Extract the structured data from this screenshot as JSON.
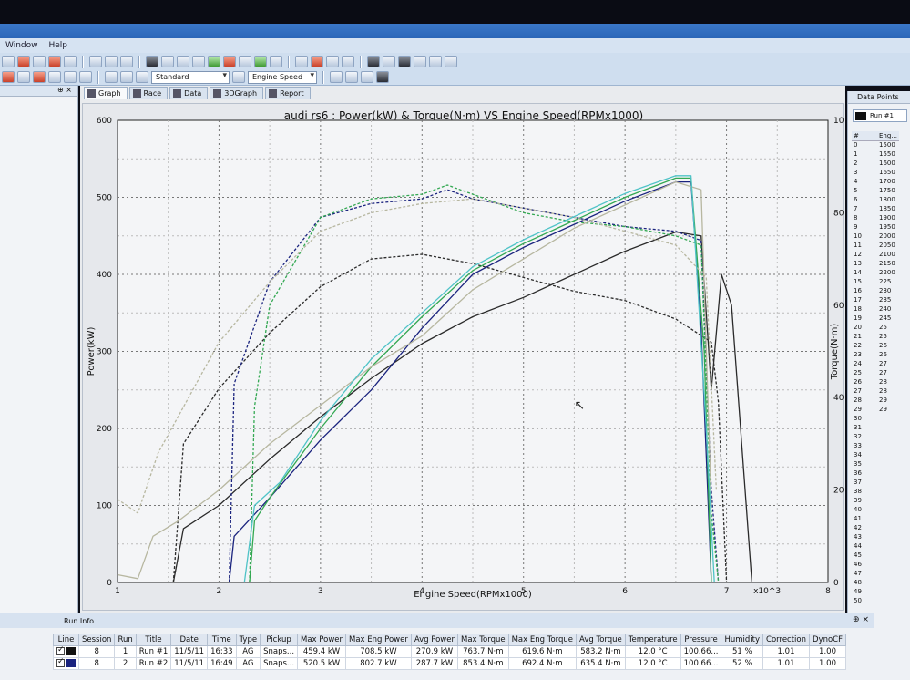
{
  "app": {
    "menu": [
      "Window",
      "Help"
    ],
    "toolbar": {
      "style_select": "Standard",
      "x_axis_select": "Engine Speed"
    },
    "left_pane_pin": "⊕ ×"
  },
  "tabs": [
    {
      "label": "Graph",
      "active": true
    },
    {
      "label": "Race",
      "active": false
    },
    {
      "label": "Data",
      "active": false
    },
    {
      "label": "3DGraph",
      "active": false
    },
    {
      "label": "Report",
      "active": false
    }
  ],
  "chart_data": {
    "type": "line",
    "title": "audi rs6 : Power(kW) & Torque(N·m) VS Engine Speed(RPMx1000)",
    "xlabel": "Engine Speed(RPMx1000)",
    "x_multiplier": "x10^3",
    "ylabel_left": "Power(kW)",
    "ylabel_right": "Torque(N·m)",
    "xlim": [
      1,
      8
    ],
    "ylim_left": [
      0,
      600
    ],
    "ylim_right": [
      0,
      1000
    ],
    "x_ticks": [
      1,
      2,
      3,
      4,
      5,
      6,
      7,
      8
    ],
    "y_ticks_left": [
      0,
      100,
      200,
      300,
      400,
      500,
      600
    ],
    "y_ticks_right": [
      0,
      200,
      400,
      600,
      800,
      1000
    ],
    "grid": true,
    "series": [
      {
        "color": "#2a2a2a",
        "dash": "solid",
        "axis": "left",
        "points": [
          [
            1.55,
            0
          ],
          [
            1.65,
            70
          ],
          [
            2.0,
            100
          ],
          [
            2.5,
            160
          ],
          [
            3.0,
            215
          ],
          [
            3.5,
            265
          ],
          [
            4.0,
            310
          ],
          [
            4.5,
            345
          ],
          [
            5.0,
            370
          ],
          [
            5.5,
            400
          ],
          [
            6.0,
            430
          ],
          [
            6.5,
            455
          ],
          [
            6.75,
            450
          ],
          [
            6.85,
            250
          ],
          [
            6.95,
            400
          ],
          [
            7.05,
            360
          ],
          [
            7.25,
            0
          ]
        ]
      },
      {
        "color": "#2a2a2a",
        "dash": "dashed",
        "axis": "right",
        "points": [
          [
            1.55,
            0
          ],
          [
            1.65,
            300
          ],
          [
            2.0,
            420
          ],
          [
            2.5,
            540
          ],
          [
            3.0,
            640
          ],
          [
            3.5,
            700
          ],
          [
            4.0,
            710
          ],
          [
            4.5,
            690
          ],
          [
            5.0,
            660
          ],
          [
            5.5,
            630
          ],
          [
            6.0,
            610
          ],
          [
            6.5,
            570
          ],
          [
            6.85,
            520
          ],
          [
            6.92,
            390
          ],
          [
            7.0,
            0
          ]
        ]
      },
      {
        "color": "#1a237e",
        "dash": "solid",
        "axis": "left",
        "points": [
          [
            2.1,
            0
          ],
          [
            2.15,
            60
          ],
          [
            2.5,
            110
          ],
          [
            3.0,
            185
          ],
          [
            3.5,
            250
          ],
          [
            4.0,
            330
          ],
          [
            4.5,
            400
          ],
          [
            5.0,
            435
          ],
          [
            5.5,
            465
          ],
          [
            6.0,
            495
          ],
          [
            6.5,
            520
          ],
          [
            6.65,
            520
          ],
          [
            6.75,
            330
          ],
          [
            6.85,
            0
          ]
        ]
      },
      {
        "color": "#1a237e",
        "dash": "dashed",
        "axis": "right",
        "points": [
          [
            2.1,
            0
          ],
          [
            2.15,
            430
          ],
          [
            2.5,
            650
          ],
          [
            3.0,
            790
          ],
          [
            3.5,
            820
          ],
          [
            4.0,
            830
          ],
          [
            4.25,
            850
          ],
          [
            4.5,
            830
          ],
          [
            5.0,
            810
          ],
          [
            5.5,
            790
          ],
          [
            6.0,
            770
          ],
          [
            6.5,
            760
          ],
          [
            6.75,
            740
          ],
          [
            6.85,
            200
          ],
          [
            6.92,
            0
          ]
        ]
      },
      {
        "color": "#33a852",
        "dash": "solid",
        "axis": "left",
        "points": [
          [
            2.3,
            0
          ],
          [
            2.35,
            80
          ],
          [
            2.5,
            110
          ],
          [
            3.0,
            200
          ],
          [
            3.5,
            280
          ],
          [
            4.0,
            345
          ],
          [
            4.5,
            405
          ],
          [
            5.0,
            440
          ],
          [
            5.5,
            470
          ],
          [
            6.0,
            500
          ],
          [
            6.5,
            525
          ],
          [
            6.65,
            525
          ],
          [
            6.78,
            300
          ],
          [
            6.85,
            0
          ]
        ]
      },
      {
        "color": "#33a852",
        "dash": "dashed",
        "axis": "right",
        "points": [
          [
            2.3,
            0
          ],
          [
            2.35,
            380
          ],
          [
            2.5,
            600
          ],
          [
            3.0,
            790
          ],
          [
            3.5,
            830
          ],
          [
            4.0,
            840
          ],
          [
            4.25,
            860
          ],
          [
            4.5,
            840
          ],
          [
            5.0,
            800
          ],
          [
            5.5,
            780
          ],
          [
            6.0,
            770
          ],
          [
            6.5,
            750
          ],
          [
            6.75,
            730
          ],
          [
            6.85,
            150
          ],
          [
            6.92,
            0
          ]
        ]
      },
      {
        "color": "#b7b7a0",
        "dash": "solid",
        "axis": "left",
        "points": [
          [
            1.0,
            10
          ],
          [
            1.2,
            5
          ],
          [
            1.35,
            60
          ],
          [
            1.6,
            80
          ],
          [
            2.0,
            120
          ],
          [
            2.5,
            180
          ],
          [
            3.0,
            230
          ],
          [
            3.5,
            280
          ],
          [
            4.0,
            320
          ],
          [
            4.5,
            380
          ],
          [
            5.0,
            420
          ],
          [
            5.5,
            460
          ],
          [
            6.0,
            490
          ],
          [
            6.5,
            520
          ],
          [
            6.75,
            510
          ],
          [
            6.85,
            100
          ]
        ]
      },
      {
        "color": "#b7b7a0",
        "dash": "dashed",
        "axis": "right",
        "points": [
          [
            1.0,
            180
          ],
          [
            1.2,
            150
          ],
          [
            1.4,
            280
          ],
          [
            1.7,
            400
          ],
          [
            2.0,
            520
          ],
          [
            2.5,
            650
          ],
          [
            3.0,
            760
          ],
          [
            3.5,
            800
          ],
          [
            4.0,
            820
          ],
          [
            4.5,
            830
          ],
          [
            5.0,
            810
          ],
          [
            5.5,
            790
          ],
          [
            6.0,
            760
          ],
          [
            6.5,
            730
          ],
          [
            6.8,
            660
          ],
          [
            6.9,
            200
          ]
        ]
      },
      {
        "color": "#4fc3c7",
        "dash": "solid",
        "axis": "left",
        "points": [
          [
            2.25,
            0
          ],
          [
            2.35,
            100
          ],
          [
            2.6,
            130
          ],
          [
            3.0,
            210
          ],
          [
            3.5,
            290
          ],
          [
            4.0,
            350
          ],
          [
            4.5,
            410
          ],
          [
            5.0,
            445
          ],
          [
            5.5,
            475
          ],
          [
            6.0,
            505
          ],
          [
            6.5,
            528
          ],
          [
            6.65,
            528
          ],
          [
            6.8,
            200
          ],
          [
            6.88,
            0
          ]
        ]
      }
    ]
  },
  "cursor": "↖",
  "data_points": {
    "title": "Data Points",
    "run_label": "Run #1",
    "headers": [
      "#",
      "Eng..."
    ],
    "rows": [
      [
        "0",
        "1500"
      ],
      [
        "1",
        "1550"
      ],
      [
        "2",
        "1600"
      ],
      [
        "3",
        "1650"
      ],
      [
        "4",
        "1700"
      ],
      [
        "5",
        "1750"
      ],
      [
        "6",
        "1800"
      ],
      [
        "7",
        "1850"
      ],
      [
        "8",
        "1900"
      ],
      [
        "9",
        "1950"
      ],
      [
        "10",
        "2000"
      ],
      [
        "11",
        "2050"
      ],
      [
        "12",
        "2100"
      ],
      [
        "13",
        "2150"
      ],
      [
        "14",
        "2200"
      ],
      [
        "15",
        "225"
      ],
      [
        "16",
        "230"
      ],
      [
        "17",
        "235"
      ],
      [
        "18",
        "240"
      ],
      [
        "19",
        "245"
      ],
      [
        "20",
        "25"
      ],
      [
        "21",
        "25"
      ],
      [
        "22",
        "26"
      ],
      [
        "23",
        "26"
      ],
      [
        "24",
        "27"
      ],
      [
        "25",
        "27"
      ],
      [
        "26",
        "28"
      ],
      [
        "27",
        "28"
      ],
      [
        "28",
        "29"
      ],
      [
        "29",
        "29"
      ],
      [
        "30",
        ""
      ],
      [
        "31",
        ""
      ],
      [
        "32",
        ""
      ],
      [
        "33",
        ""
      ],
      [
        "34",
        ""
      ],
      [
        "35",
        ""
      ],
      [
        "36",
        ""
      ],
      [
        "37",
        ""
      ],
      [
        "38",
        ""
      ],
      [
        "39",
        ""
      ],
      [
        "40",
        ""
      ],
      [
        "41",
        ""
      ],
      [
        "42",
        ""
      ],
      [
        "43",
        ""
      ],
      [
        "44",
        ""
      ],
      [
        "45",
        ""
      ],
      [
        "46",
        ""
      ],
      [
        "47",
        ""
      ],
      [
        "48",
        ""
      ],
      [
        "49",
        ""
      ],
      [
        "50",
        ""
      ]
    ]
  },
  "run_info": {
    "title": "Run Info",
    "pin": "⊕ ×",
    "columns": [
      "Line",
      "Session",
      "Run",
      "Title",
      "Date",
      "Time",
      "Type",
      "Pickup",
      "Max Power",
      "Max Eng Power",
      "Avg Power",
      "Max Torque",
      "Max Eng Torque",
      "Avg Torque",
      "Temperature",
      "Pressure",
      "Humidity",
      "Correction",
      "DynoCF"
    ],
    "rows": [
      {
        "color": "#111111",
        "cells": [
          "8",
          "1",
          "Run #1",
          "11/5/11",
          "16:33",
          "AG",
          "Snaps...",
          "459.4 kW",
          "708.5 kW",
          "270.9 kW",
          "763.7 N·m",
          "619.6 N·m",
          "583.2 N·m",
          "12.0 °C",
          "100.66...",
          "51 %",
          "1.01",
          "1.00"
        ]
      },
      {
        "color": "#1a237e",
        "cells": [
          "8",
          "2",
          "Run #2",
          "11/5/11",
          "16:49",
          "AG",
          "Snaps...",
          "520.5 kW",
          "802.7 kW",
          "287.7 kW",
          "853.4 N·m",
          "692.4 N·m",
          "635.4 N·m",
          "12.0 °C",
          "100.66...",
          "52 %",
          "1.01",
          "1.00"
        ]
      }
    ]
  }
}
